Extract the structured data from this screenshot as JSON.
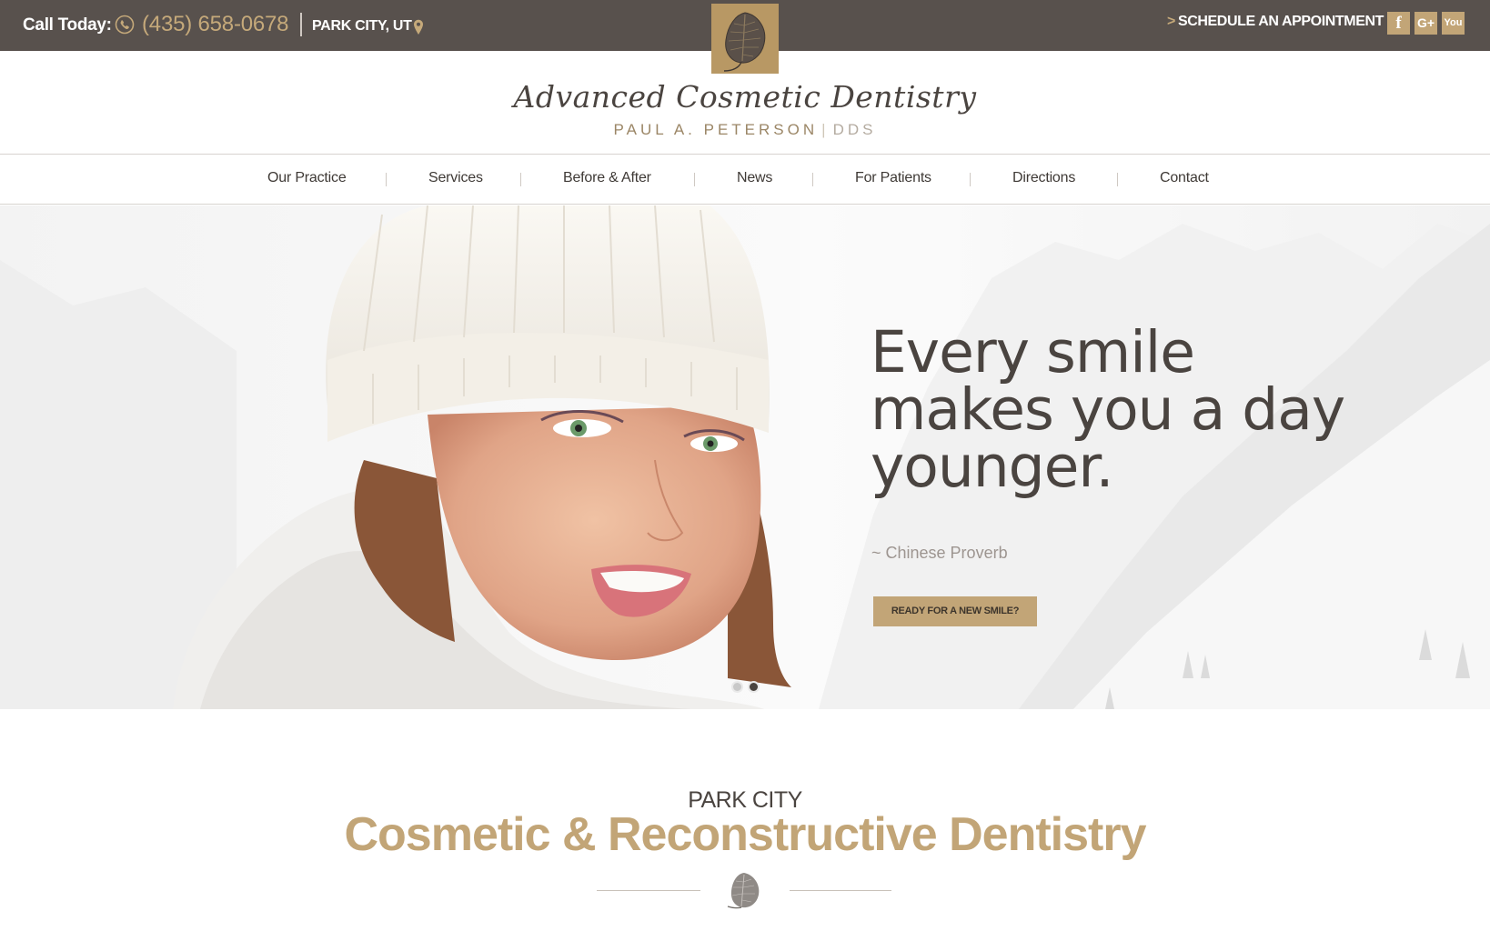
{
  "topbar": {
    "call_label": "Call Today:",
    "phone": "(435) 658-0678",
    "location": "PARK CITY, UT",
    "schedule_arrow": ">",
    "schedule_label": "SCHEDULE AN APPOINTMENT",
    "social": {
      "facebook": "f",
      "googleplus": "G+",
      "youtube": "You"
    }
  },
  "logo": {
    "script_name": "Advanced Cosmetic Dentistry",
    "doctor_name": "PAUL A. PETERSON",
    "divider": "|",
    "credential": "DDS"
  },
  "nav": {
    "items": [
      {
        "label": "Our Practice"
      },
      {
        "label": "Services"
      },
      {
        "label": "Before & After"
      },
      {
        "label": "News"
      },
      {
        "label": "For Patients"
      },
      {
        "label": "Directions"
      },
      {
        "label": "Contact"
      }
    ]
  },
  "hero": {
    "quote_line1": "Every smile",
    "quote_line2": "makes you a day",
    "quote_line3": "younger.",
    "attribution": "~ Chinese Proverb",
    "cta_label": "READY FOR A NEW SMILE?",
    "slides": {
      "count": 2,
      "active": 2
    }
  },
  "section": {
    "eyebrow": "PARK CITY",
    "heading": "Cosmetic & Reconstructive Dentistry"
  },
  "colors": {
    "topbar_bg": "#58514d",
    "accent_gold": "#c2a577",
    "text_dark": "#4a4440"
  },
  "icons": {
    "phone": "phone-icon",
    "location": "map-pin-icon",
    "leaf": "aspen-leaf-icon"
  }
}
